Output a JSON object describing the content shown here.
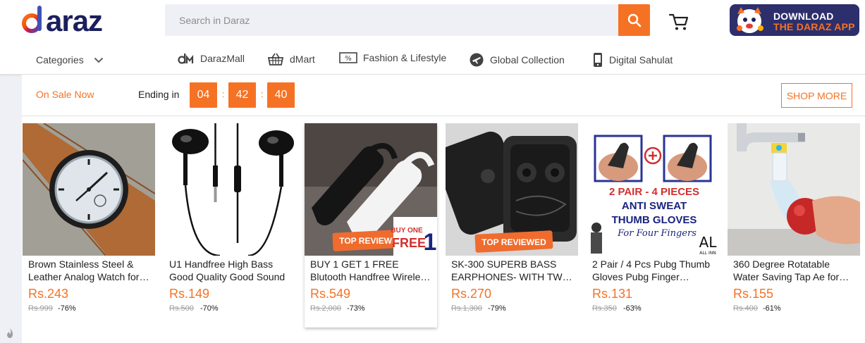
{
  "header": {
    "logo_text": "daraz",
    "search": {
      "placeholder": "Search in Daraz",
      "value": ""
    },
    "app_banner": {
      "line1": "DOWNLOAD",
      "line2": "THE DARAZ APP"
    }
  },
  "nav": {
    "categories_label": "Categories",
    "items": [
      {
        "label": "DarazMall",
        "icon": "darazmall-icon"
      },
      {
        "label": "dMart",
        "icon": "basket-icon"
      },
      {
        "label": "Fashion & Lifestyle",
        "icon": "discount-tag-icon"
      },
      {
        "label": "Global Collection",
        "icon": "plane-icon"
      },
      {
        "label": "Digital Sahulat",
        "icon": "mobile-icon"
      }
    ]
  },
  "flash_sale": {
    "on_sale_label": "On Sale Now",
    "ending_label": "Ending in",
    "timer": {
      "hours": "04",
      "minutes": "42",
      "seconds": "40",
      "separator": ":"
    },
    "shop_more_label": "SHOP MORE"
  },
  "products": [
    {
      "title": "Brown Stainless Steel & Leather Analog Watch for Men",
      "price": "Rs.243",
      "original_price": "Rs.999",
      "discount": "-76%"
    },
    {
      "title": "U1 Handfree High Bass Good Quality Good Sound",
      "price": "Rs.149",
      "original_price": "Rs.500",
      "discount": "-70%"
    },
    {
      "title": "BUY 1 GET 1 FREE Blutooth Handfree Wireless Headset",
      "price": "Rs.549",
      "original_price": "Rs.2,000",
      "discount": "-73%",
      "badge": "TOP REVIEWED",
      "promo": [
        "BUY ONE",
        "FREE",
        "1"
      ]
    },
    {
      "title": "SK-300 SUPERB BASS EARPHONES- WITH TWO EXTRA BUDS",
      "price": "Rs.270",
      "original_price": "Rs.1,300",
      "discount": "-79%",
      "badge": "TOP REVIEWED"
    },
    {
      "title": "2 Pair / 4 Pcs Pubg Thumb Gloves Pubg Finger Sleeves",
      "price": "Rs.131",
      "original_price": "Rs.350",
      "discount": "-63%",
      "image_text": [
        "2 PAIR - 4 PIECES",
        "ANTI SWEAT",
        "THUMB GLOVES",
        "For Four Fingers"
      ],
      "brand_mark": "AL",
      "brand_sub": "ALL INN"
    },
    {
      "title": "360 Degree Rotatable Water Saving Tap Ae for Kitchen",
      "price": "Rs.155",
      "original_price": "Rs.400",
      "discount": "-61%"
    }
  ],
  "colors": {
    "accent": "#f57224",
    "banner_bg": "#2c2f6b"
  }
}
